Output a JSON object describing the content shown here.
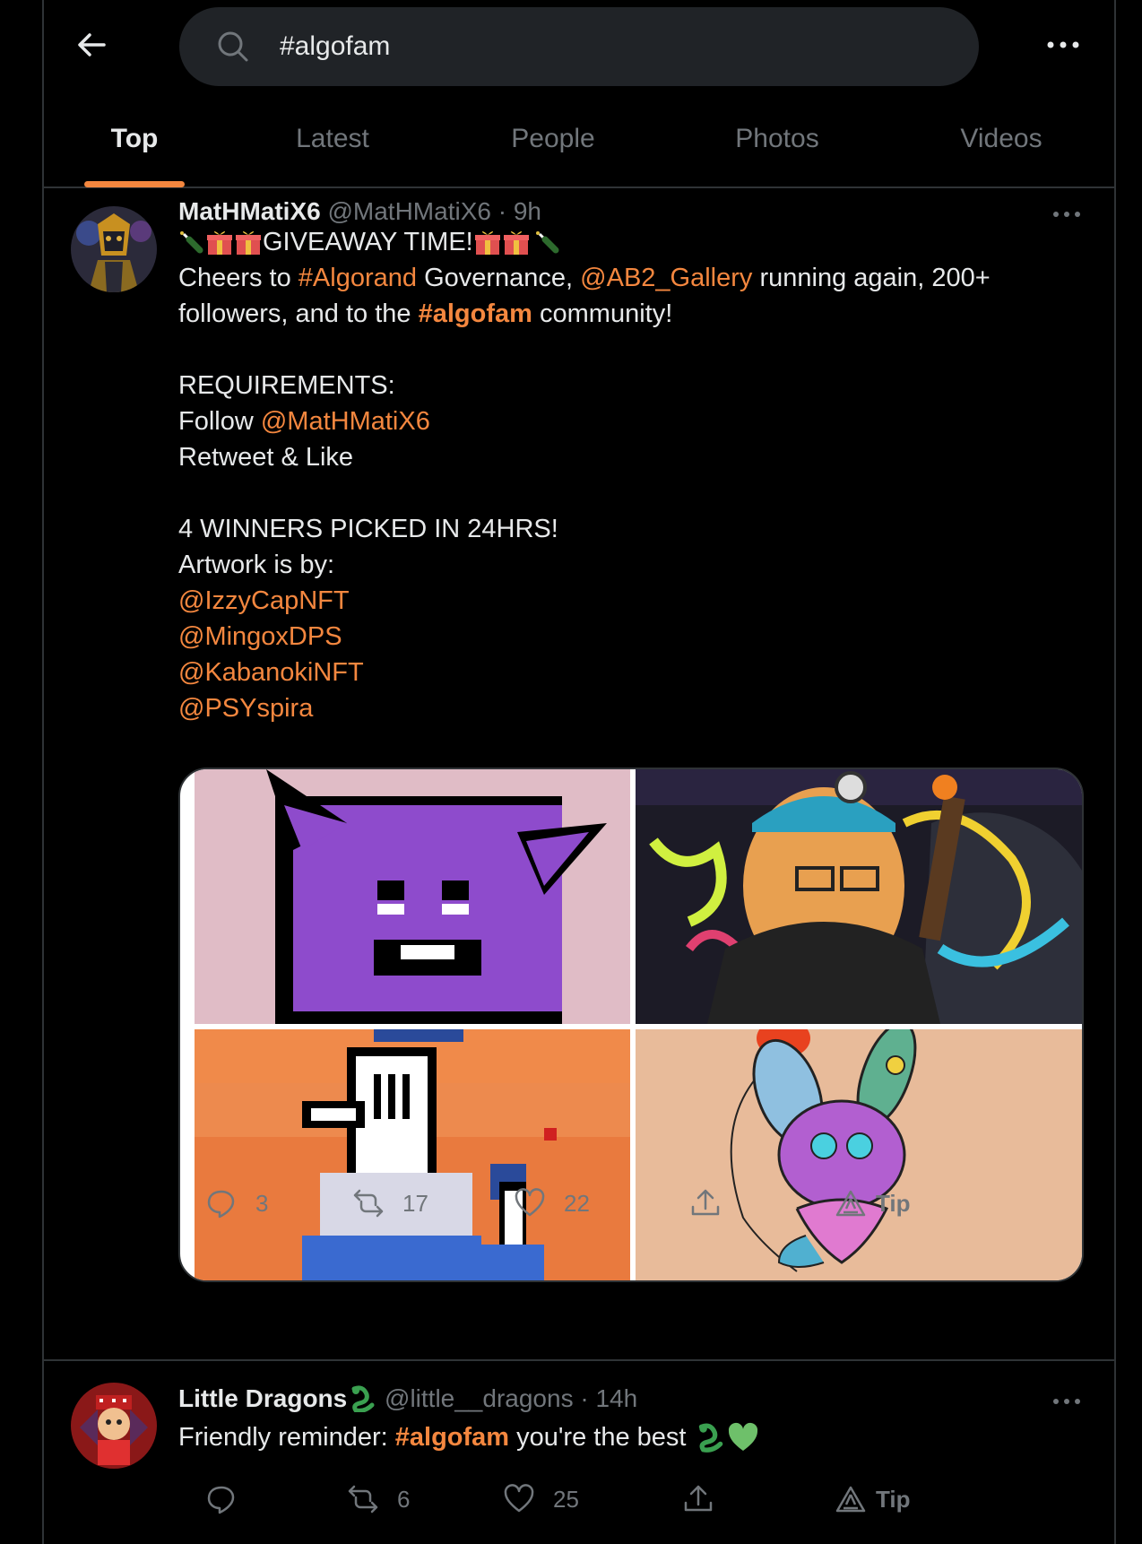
{
  "search": {
    "value": "#algofam"
  },
  "tabs": [
    {
      "label": "Top"
    },
    {
      "label": "Latest"
    },
    {
      "label": "People"
    },
    {
      "label": "Photos"
    },
    {
      "label": "Videos"
    }
  ],
  "accent_color": "#f4873f",
  "tweets": [
    {
      "display_name": "MatHMatiX6",
      "handle": "@MatHMatiX6",
      "separator": "·",
      "time": "9h",
      "title_line": "GIVEAWAY TIME!",
      "text": {
        "l2a": "Cheers to ",
        "l2_tag": "#Algorand",
        "l2b": " Governance, ",
        "l2_mention": "@AB2_Gallery",
        "l2c": " running again, 200+",
        "l3a": "followers, and to the ",
        "l3_tag": "#algofam",
        "l3b": " community!",
        "req": "REQUIREMENTS:",
        "follow": "Follow ",
        "follow_mention": "@MatHMatiX6",
        "rt": "Retweet & Like",
        "winners": "4 WINNERS PICKED IN 24HRS!",
        "artwork": "Artwork is by:",
        "artists": [
          "@IzzyCapNFT",
          "@MingoxDPS",
          "@KabanokiNFT",
          "@PSYspira"
        ]
      },
      "stats": {
        "replies": "3",
        "retweets": "17",
        "likes": "22",
        "tip": "Tip"
      }
    },
    {
      "display_name": "Little Dragons",
      "handle": "@little__dragons",
      "separator": "·",
      "time": "14h",
      "text": {
        "a": "Friendly reminder: ",
        "tag": "#algofam",
        "b": " you're the best "
      },
      "stats": {
        "replies": "",
        "retweets": "6",
        "likes": "25",
        "tip": "Tip"
      }
    }
  ]
}
